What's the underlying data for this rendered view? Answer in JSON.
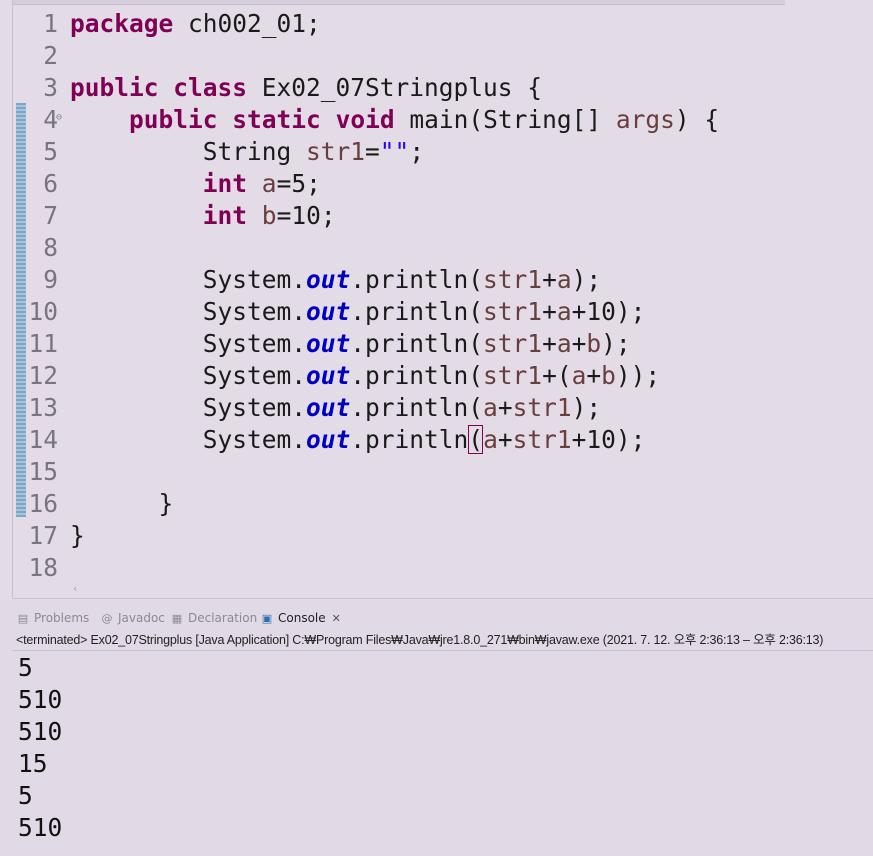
{
  "editor": {
    "lines": [
      {
        "n": "1",
        "tokens": [
          {
            "t": "package",
            "c": "kw"
          },
          {
            "t": " ch002_01;"
          }
        ]
      },
      {
        "n": "2",
        "tokens": []
      },
      {
        "n": "3",
        "tokens": [
          {
            "t": "public",
            "c": "kw"
          },
          {
            "t": " "
          },
          {
            "t": "class",
            "c": "kw"
          },
          {
            "t": " Ex02_07Stringplus {"
          }
        ]
      },
      {
        "n": "4",
        "fold": true,
        "tokens": [
          {
            "t": "    "
          },
          {
            "t": "public",
            "c": "kw"
          },
          {
            "t": " "
          },
          {
            "t": "static",
            "c": "kw"
          },
          {
            "t": " "
          },
          {
            "t": "void",
            "c": "kw"
          },
          {
            "t": " main(String[] "
          },
          {
            "t": "args",
            "c": "vr"
          },
          {
            "t": ") {"
          }
        ]
      },
      {
        "n": "5",
        "tokens": [
          {
            "t": "         String "
          },
          {
            "t": "str1",
            "c": "vr"
          },
          {
            "t": "="
          },
          {
            "t": "\"\"",
            "c": "st"
          },
          {
            "t": ";"
          }
        ]
      },
      {
        "n": "6",
        "tokens": [
          {
            "t": "         "
          },
          {
            "t": "int",
            "c": "kw"
          },
          {
            "t": " "
          },
          {
            "t": "a",
            "c": "vr"
          },
          {
            "t": "=5;"
          }
        ]
      },
      {
        "n": "7",
        "tokens": [
          {
            "t": "         "
          },
          {
            "t": "int",
            "c": "kw"
          },
          {
            "t": " "
          },
          {
            "t": "b",
            "c": "vr"
          },
          {
            "t": "=10;"
          }
        ]
      },
      {
        "n": "8",
        "tokens": []
      },
      {
        "n": "9",
        "tokens": [
          {
            "t": "         System."
          },
          {
            "t": "out",
            "c": "fld"
          },
          {
            "t": ".println("
          },
          {
            "t": "str1",
            "c": "vr"
          },
          {
            "t": "+"
          },
          {
            "t": "a",
            "c": "vr"
          },
          {
            "t": ");"
          }
        ]
      },
      {
        "n": "10",
        "tokens": [
          {
            "t": "         System."
          },
          {
            "t": "out",
            "c": "fld"
          },
          {
            "t": ".println("
          },
          {
            "t": "str1",
            "c": "vr"
          },
          {
            "t": "+"
          },
          {
            "t": "a",
            "c": "vr"
          },
          {
            "t": "+10);"
          }
        ]
      },
      {
        "n": "11",
        "tokens": [
          {
            "t": "         System."
          },
          {
            "t": "out",
            "c": "fld"
          },
          {
            "t": ".println("
          },
          {
            "t": "str1",
            "c": "vr"
          },
          {
            "t": "+"
          },
          {
            "t": "a",
            "c": "vr"
          },
          {
            "t": "+"
          },
          {
            "t": "b",
            "c": "vr"
          },
          {
            "t": ");"
          }
        ]
      },
      {
        "n": "12",
        "tokens": [
          {
            "t": "         System."
          },
          {
            "t": "out",
            "c": "fld"
          },
          {
            "t": ".println("
          },
          {
            "t": "str1",
            "c": "vr"
          },
          {
            "t": "+("
          },
          {
            "t": "a",
            "c": "vr"
          },
          {
            "t": "+"
          },
          {
            "t": "b",
            "c": "vr"
          },
          {
            "t": "));"
          }
        ]
      },
      {
        "n": "13",
        "tokens": [
          {
            "t": "         System."
          },
          {
            "t": "out",
            "c": "fld"
          },
          {
            "t": ".println("
          },
          {
            "t": "a",
            "c": "vr"
          },
          {
            "t": "+"
          },
          {
            "t": "str1",
            "c": "vr"
          },
          {
            "t": ");"
          }
        ]
      },
      {
        "n": "14",
        "tokens": [
          {
            "t": "         System."
          },
          {
            "t": "out",
            "c": "fld"
          },
          {
            "t": ".println"
          },
          {
            "t": "(",
            "c": "caret"
          },
          {
            "t": "a",
            "c": "vr"
          },
          {
            "t": "+"
          },
          {
            "t": "str1",
            "c": "vr"
          },
          {
            "t": "+10);"
          }
        ]
      },
      {
        "n": "15",
        "tokens": []
      },
      {
        "n": "16",
        "tokens": [
          {
            "t": "      }"
          }
        ]
      },
      {
        "n": "17",
        "tokens": [
          {
            "t": "}"
          }
        ]
      },
      {
        "n": "18",
        "tokens": []
      }
    ]
  },
  "tabs": [
    {
      "label": "Problems",
      "icon": "problems-icon",
      "glyph": "▤",
      "active": false
    },
    {
      "label": "Javadoc",
      "icon": "javadoc-icon",
      "glyph": "@",
      "active": false
    },
    {
      "label": "Declaration",
      "icon": "declaration-icon",
      "glyph": "▦",
      "active": false
    },
    {
      "label": "Console",
      "icon": "console-icon",
      "glyph": "▣",
      "active": true
    }
  ],
  "console_close_glyph": "✕",
  "status": "<terminated> Ex02_07Stringplus [Java Application] C:₩Program Files₩Java₩jre1.8.0_271₩bin₩javaw.exe  (2021. 7. 12. 오후 2:36:13 – 오후 2:36:13)",
  "console_output": [
    "5",
    "510",
    "510",
    "15",
    "5",
    "510"
  ],
  "colors": {
    "keyword": "#7f0055",
    "variable": "#6a3e3e",
    "string": "#2a00ff",
    "field": "#0000c0",
    "background": "#e3dbe6"
  }
}
